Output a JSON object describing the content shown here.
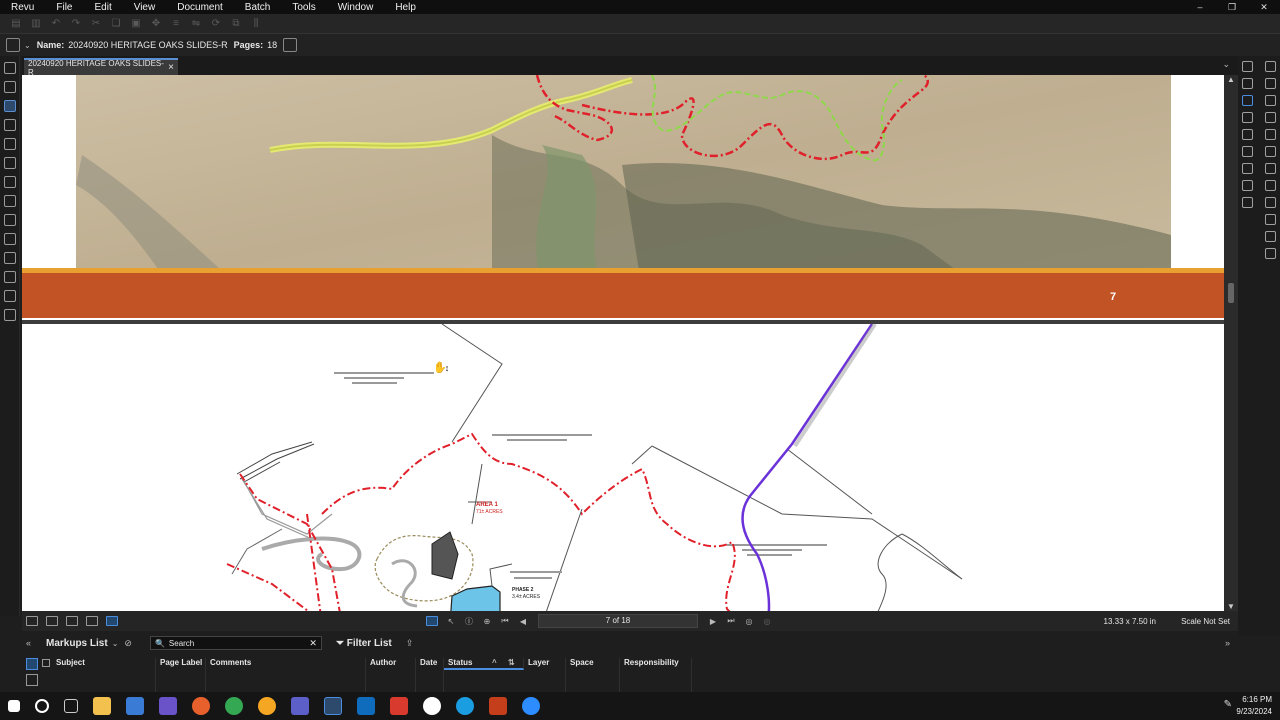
{
  "menu": [
    "Revu",
    "File",
    "Edit",
    "View",
    "Document",
    "Batch",
    "Tools",
    "Window",
    "Help"
  ],
  "doc_info": {
    "name_label": "Name:",
    "name": "20240920 HERITAGE OAKS SLIDES-R",
    "pages_label": "Pages:",
    "pages": "18"
  },
  "tab": {
    "title": "20240920 HERITAGE OAKS SLIDES-R",
    "close": "×"
  },
  "slide": {
    "page_number": "7"
  },
  "drawing_labels": {
    "area": "AREA 1",
    "area_acres": "71± ACRES",
    "phase": "PHASE 2",
    "phase_acres": "3.4± ACRES"
  },
  "status": {
    "page_field": "7 of 18",
    "dimensions": "13.33 x 7.50 in",
    "scale": "Scale Not Set"
  },
  "markups": {
    "title": "Markups List",
    "search_placeholder": "Search",
    "filter": "Filter List",
    "columns": [
      "Subject",
      "Page Label",
      "Comments",
      "Author",
      "Date",
      "Status",
      "Layer",
      "Space",
      "Responsibility"
    ]
  },
  "clock": {
    "time": "6:16 PM",
    "date": "9/23/2024"
  },
  "colors": {
    "accent": "#4b8ee0",
    "orange_band": "#c25325",
    "orange_line": "#e8a030"
  }
}
